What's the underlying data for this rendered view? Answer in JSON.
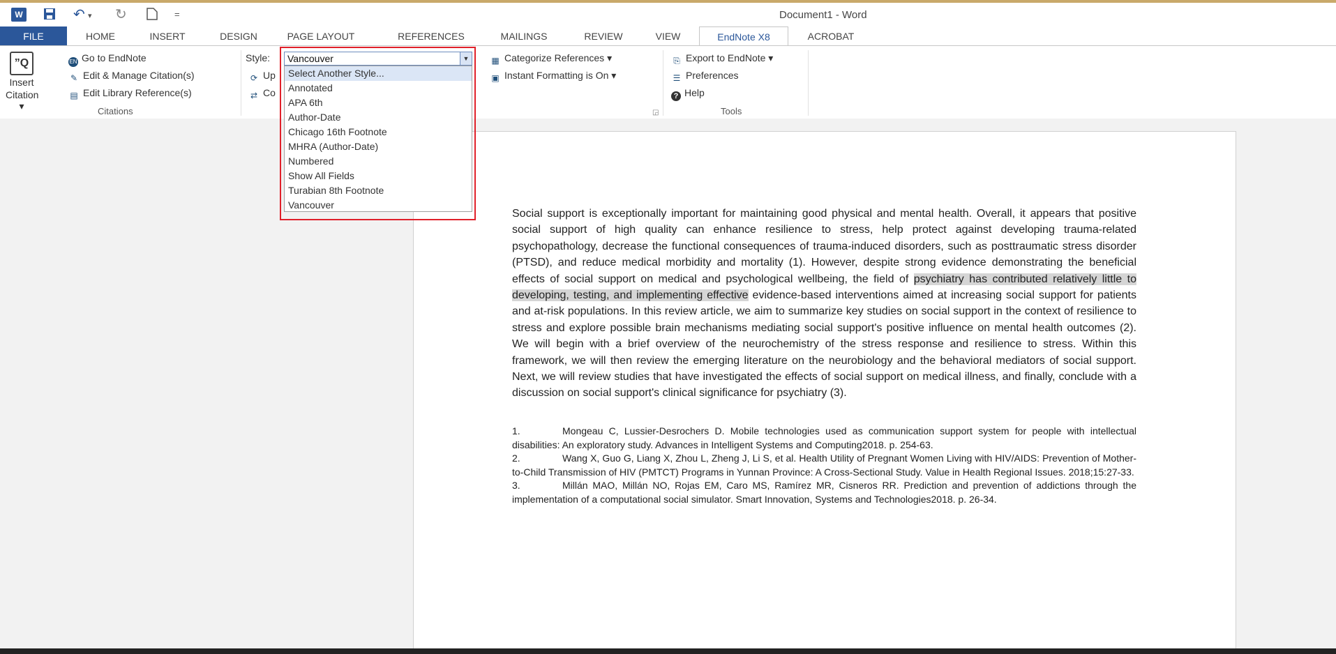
{
  "title_bar": {
    "logo": "W",
    "title": "Document1 - Word"
  },
  "quick_access": {
    "icons": [
      "save-icon",
      "undo-icon",
      "redo-icon",
      "new-document-icon",
      "customize-icon"
    ],
    "undo_arrow": "▾",
    "customize": "="
  },
  "tabs": [
    {
      "label": "FILE"
    },
    {
      "label": "HOME"
    },
    {
      "label": "INSERT"
    },
    {
      "label": "DESIGN"
    },
    {
      "label": "PAGE LAYOUT"
    },
    {
      "label": "REFERENCES"
    },
    {
      "label": "MAILINGS"
    },
    {
      "label": "REVIEW"
    },
    {
      "label": "VIEW"
    },
    {
      "label": "EndNote X8"
    },
    {
      "label": "ACROBAT"
    }
  ],
  "active_tab": "EndNote X8",
  "ribbon": {
    "insert_citation": {
      "line1": "Insert",
      "line2": "Citation ▾"
    },
    "citations": {
      "go_to_endnote": "Go to EndNote",
      "edit_manage": "Edit & Manage Citation(s)",
      "edit_library": "Edit Library Reference(s)",
      "group_label": "Citations"
    },
    "bibliography": {
      "style_label": "Style:",
      "style_value": "Vancouver",
      "update_partial": "Up",
      "convert_partial": "Co",
      "categorize": "Categorize References ▾",
      "instant_formatting": "Instant Formatting is On ▾"
    },
    "tools": {
      "export": "Export to EndNote ▾",
      "preferences": "Preferences",
      "help": "Help",
      "group_label": "Tools"
    }
  },
  "style_dropdown": {
    "items": [
      "Select Another Style...",
      "Annotated",
      "APA 6th",
      "Author-Date",
      "Chicago 16th Footnote",
      "MHRA (Author-Date)",
      "Numbered",
      "Show All Fields",
      "Turabian 8th Footnote",
      "Vancouver"
    ],
    "highlighted_index": 0
  },
  "document": {
    "paragraph_before": "Social support is exceptionally important for maintaining good physical and mental health. Overall, it appears that positive social support of high quality can enhance resilience to stress, help protect against developing trauma-related psychopathology, decrease the functional consequences of trauma-induced disorders, such as posttraumatic stress disorder (PTSD), and reduce medical morbidity and mortality (1). However, despite strong evidence demonstrating the beneficial effects of social support on medical and psychological wellbeing, the field of ",
    "paragraph_highlight": "psychiatry has contributed relatively little to developing, testing, and implementing effective",
    "paragraph_after": " evidence-based interventions aimed at increasing social support for patients and at-risk populations. In this review article, we aim to summarize key studies on social support in the context of resilience to stress and explore possible brain mechanisms mediating social support's positive influence on mental health outcomes (2). We will begin with a brief overview of the neurochemistry of the stress response and resilience to stress. Within this framework, we will then review the emerging literature on the neurobiology and the behavioral mediators of social support. Next, we will review studies that have investigated the effects of social support on medical illness, and finally, conclude with a discussion on social support's clinical significance for psychiatry (3).",
    "references": [
      {
        "num": "1.",
        "text": "Mongeau C, Lussier-Desrochers D. Mobile technologies used as communication support system for people with intellectual disabilities: An exploratory study. Advances in Intelligent Systems and Computing2018. p. 254-63."
      },
      {
        "num": "2.",
        "text": "Wang X, Guo G, Liang X, Zhou L, Zheng J, Li S, et al. Health Utility of Pregnant Women Living with HIV/AIDS: Prevention of Mother-to-Child Transmission of HIV (PMTCT) Programs in Yunnan Province: A Cross-Sectional Study. Value in Health Regional Issues. 2018;15:27-33."
      },
      {
        "num": "3.",
        "text": "Millán MAO, Millán NO, Rojas EM, Caro MS, Ramírez MR, Cisneros RR. Prediction and prevention of addictions through the implementation of a computational social simulator. Smart Innovation, Systems and Technologies2018. p. 26-34."
      }
    ]
  },
  "colors": {
    "word_blue": "#2b579a",
    "dropdown_highlight": "#dbe6f6",
    "annotation_red": "#e0202a",
    "text_highlight": "#d5d5d5"
  }
}
